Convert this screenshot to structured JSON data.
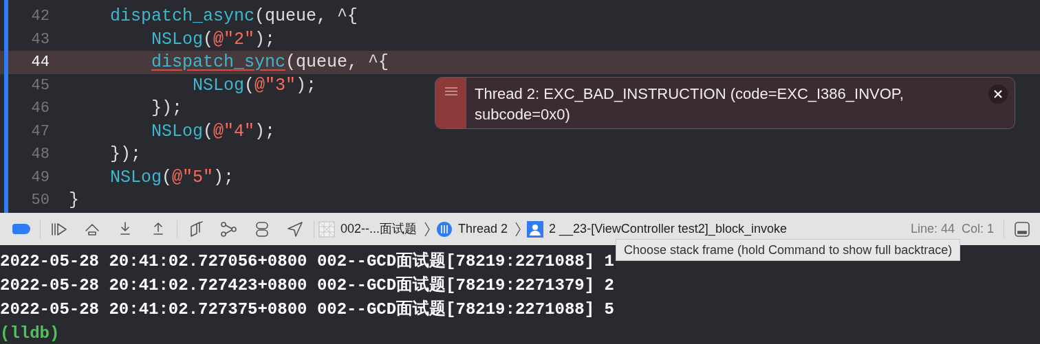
{
  "editor": {
    "lines": [
      {
        "number": "42",
        "current": false,
        "tokens": [
          {
            "text": "    dispatch_async",
            "kind": "func"
          },
          {
            "text": "(queue, ^{",
            "kind": "plain"
          }
        ]
      },
      {
        "number": "43",
        "current": false,
        "tokens": [
          {
            "text": "        NSLog",
            "kind": "func"
          },
          {
            "text": "(",
            "kind": "plain"
          },
          {
            "text": "@\"2\"",
            "kind": "string"
          },
          {
            "text": ");",
            "kind": "plain"
          }
        ]
      },
      {
        "number": "44",
        "current": true,
        "tokens": [
          {
            "text": "        dispatch_sync",
            "kind": "error"
          },
          {
            "text": "(queue, ^{",
            "kind": "plain"
          }
        ]
      },
      {
        "number": "45",
        "current": false,
        "tokens": [
          {
            "text": "            NSLog",
            "kind": "func"
          },
          {
            "text": "(",
            "kind": "plain"
          },
          {
            "text": "@\"3\"",
            "kind": "string"
          },
          {
            "text": ");",
            "kind": "plain"
          }
        ]
      },
      {
        "number": "46",
        "current": false,
        "tokens": [
          {
            "text": "        });",
            "kind": "plain"
          }
        ]
      },
      {
        "number": "47",
        "current": false,
        "tokens": [
          {
            "text": "        NSLog",
            "kind": "func"
          },
          {
            "text": "(",
            "kind": "plain"
          },
          {
            "text": "@\"4\"",
            "kind": "string"
          },
          {
            "text": ");",
            "kind": "plain"
          }
        ]
      },
      {
        "number": "48",
        "current": false,
        "tokens": [
          {
            "text": "    });",
            "kind": "plain"
          }
        ]
      },
      {
        "number": "49",
        "current": false,
        "tokens": [
          {
            "text": "    NSLog",
            "kind": "func"
          },
          {
            "text": "(",
            "kind": "plain"
          },
          {
            "text": "@\"5\"",
            "kind": "string"
          },
          {
            "text": ");",
            "kind": "plain"
          }
        ]
      },
      {
        "number": "50",
        "current": false,
        "tokens": [
          {
            "text": "}",
            "kind": "plain"
          }
        ]
      }
    ]
  },
  "error_banner": {
    "message": "Thread 2: EXC_BAD_INSTRUCTION (code=EXC_I386_INVOP, subcode=0x0)"
  },
  "debug_bar": {
    "breakpoints_on": true,
    "breadcrumbs": [
      {
        "kind": "project",
        "label": "002--...面试题"
      },
      {
        "kind": "thread",
        "label": "Thread 2"
      },
      {
        "kind": "frame",
        "label": "2 __23-[ViewController test2]_block_invoke"
      }
    ],
    "line": "Line: 44",
    "col": "Col: 1"
  },
  "tooltip": "Choose stack frame (hold Command to show full backtrace)",
  "console": {
    "lines": [
      {
        "kind": "log",
        "text": "2022-05-28 20:41:02.727056+0800 002--GCD面试题[78219:2271088] 1"
      },
      {
        "kind": "log",
        "text": "2022-05-28 20:41:02.727423+0800 002--GCD面试题[78219:2271379] 2"
      },
      {
        "kind": "log",
        "text": "2022-05-28 20:41:02.727375+0800 002--GCD面试题[78219:2271088] 5"
      },
      {
        "kind": "prompt",
        "text": "(lldb)"
      }
    ]
  }
}
